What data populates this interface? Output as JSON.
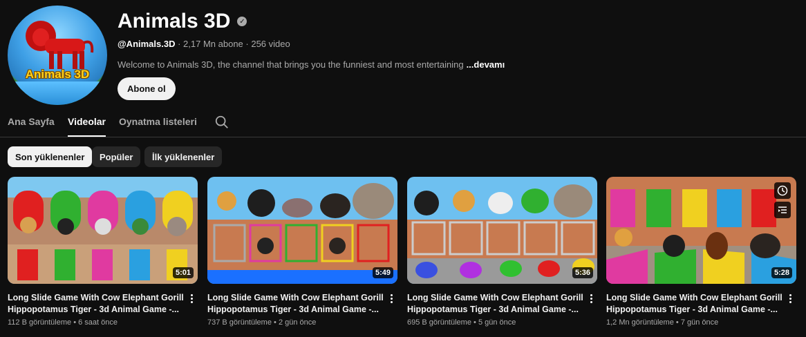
{
  "channel": {
    "name": "Animals 3D",
    "handle": "@Animals.3D",
    "stats": "· 2,17 Mn abone · 256 video",
    "description": "Welcome to Animals 3D, the channel that brings you the funniest and most entertaining",
    "more_label": "...devamı",
    "subscribe_label": "Abone ol",
    "avatar_text": "Animals 3D"
  },
  "tabs": [
    {
      "label": "Ana Sayfa"
    },
    {
      "label": "Videolar"
    },
    {
      "label": "Oynatma listeleri"
    }
  ],
  "chips": [
    {
      "label": "Son yüklenenler"
    },
    {
      "label": "Popüler"
    },
    {
      "label": "İlk yüklenenler"
    }
  ],
  "videos": [
    {
      "title_line1": "Long Slide Game With Cow Elephant Gorilla",
      "title_line2": "Hippopotamus Tiger - 3d Animal Game -...",
      "views": "112 B görüntüleme",
      "age": "6 saat önce",
      "duration": "5:01"
    },
    {
      "title_line1": "Long Slide Game With Cow Elephant Gorilla",
      "title_line2": "Hippopotamus Tiger - 3d Animal Game -...",
      "views": "737 B görüntüleme",
      "age": "2 gün önce",
      "duration": "5:49"
    },
    {
      "title_line1": "Long Slide Game With Cow Elephant Gorilla",
      "title_line2": "Hippopotamus Tiger - 3d Animal Game -...",
      "views": "695 B görüntüleme",
      "age": "5 gün önce",
      "duration": "5:36"
    },
    {
      "title_line1": "Long Slide Game With Cow Elephant Gorilla",
      "title_line2": "Hippopotamus Tiger - 3d Animal Game -...",
      "views": "1,2 Mn görüntüleme",
      "age": "7 gün önce",
      "duration": "5:28"
    }
  ],
  "meta_separator": "•",
  "colors": {
    "background": "#0f0f0f",
    "chip_bg": "#272727",
    "active_chip_bg": "#f1f1f1",
    "secondary_text": "#aaaaaa"
  },
  "icons": [
    "verified-icon",
    "search-icon",
    "more-vert-icon",
    "watch-later-icon",
    "add-to-queue-icon"
  ]
}
